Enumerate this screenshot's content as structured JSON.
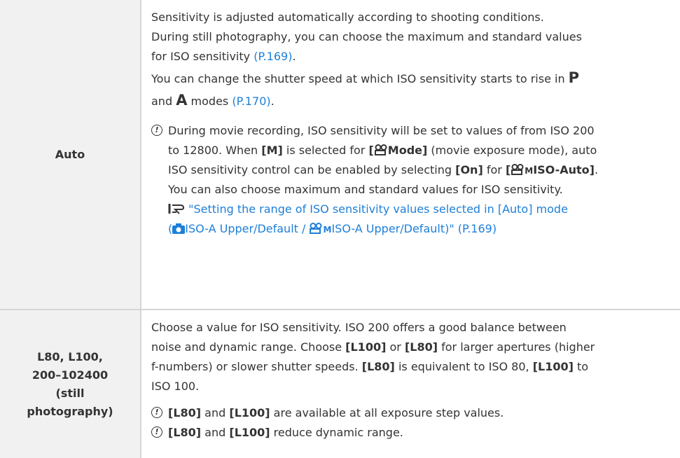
{
  "rows": [
    {
      "label": "Auto",
      "lines": [
        "Sensitivity is adjusted automatically according to shooting conditions.",
        "During still photography, you can choose the maximum and standard values",
        "for ISO sensitivity ",
        "You can change the shutter speed at which ISO sensitivity starts to rise in ",
        "and ",
        " modes "
      ],
      "link1": "(P.169)",
      "link2": "(P.170)",
      "mode_p": "P",
      "mode_a": "A",
      "period": ".",
      "note": {
        "l1": "During movie recording, ISO sensitivity will be set to values of from ISO 200",
        "l2a": "to 12800. When ",
        "l2b": "[M]",
        "l2c": " is selected for ",
        "l2d": "[",
        "l2e": "Mode]",
        "l2f": " (movie exposure mode), auto",
        "l3a": "ISO sensitivity control can be enabled by selecting ",
        "l3b": "[On]",
        "l3c": " for ",
        "l3d": "[",
        "l3e": "M",
        "l3f": "ISO-Auto]",
        "l3g": ".",
        "l4": "You can also choose maximum and standard values for ISO sensitivity.",
        "ref1": "\"Setting the range of ISO sensitivity values selected in [Auto] mode",
        "ref2a": "(",
        "ref2b": "ISO-A Upper/Default / ",
        "ref2c": "M",
        "ref2d": "ISO-A Upper/Default)\" (P.169)"
      }
    },
    {
      "label_lines": [
        "L80, L100,",
        "200–102400",
        "(still",
        "photography)"
      ],
      "lines": [
        "Choose a value for ISO sensitivity. ISO 200 offers a good balance between",
        "noise and dynamic range. Choose ",
        " or ",
        " for larger apertures (higher",
        "f-numbers) or slower shutter speeds. ",
        " is equivalent to ISO 80, ",
        " to",
        "ISO 100."
      ],
      "l100": "[L100]",
      "l80": "[L80]",
      "note1": " are available at all exposure step values.",
      "note2": " reduce dynamic range.",
      "and": " and "
    }
  ],
  "colors": {
    "link": "#1e7fd9",
    "label_bg": "#f1f1f1",
    "border": "#d6d6d6"
  },
  "icons": [
    "caution-icon",
    "movie-icon",
    "camera-icon",
    "reference-icon"
  ]
}
